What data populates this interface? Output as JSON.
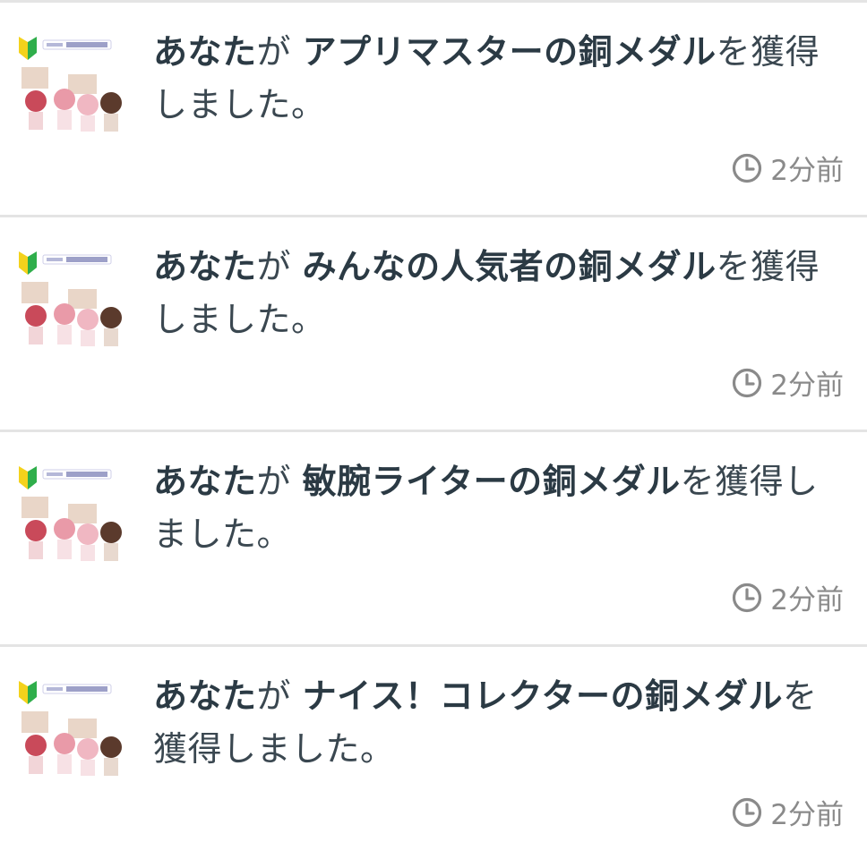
{
  "notifications": [
    {
      "actor": "あなた",
      "particle": "が",
      "badge": "アプリマスターの銅メダル",
      "suffix": "を獲得しました。",
      "time": "2分前"
    },
    {
      "actor": "あなた",
      "particle": "が",
      "badge": "みんなの人気者の銅メダル",
      "suffix": "を獲得しました。",
      "time": "2分前"
    },
    {
      "actor": "あなた",
      "particle": "が",
      "badge": "敏腕ライターの銅メダル",
      "suffix": "を獲得しました。",
      "time": "2分前"
    },
    {
      "actor": "あなた",
      "particle": "が",
      "badge": "ナイス！コレクターの銅メダル",
      "suffix": "を獲得しました。",
      "time": "2分前"
    }
  ],
  "avatar": {
    "icon": "beginner-mark-icon",
    "logo_text": "はじめてのマイネ王",
    "colors": {
      "mark_green": "#2fae4b",
      "mark_yellow": "#f4d21c",
      "pink": "#e99aa8",
      "brown": "#5b3a2c",
      "sign": "#e9d6c8"
    }
  },
  "theme": {
    "divider": "#e4e4e4",
    "text": "#2b3a44",
    "meta": "#8a8a8a"
  }
}
